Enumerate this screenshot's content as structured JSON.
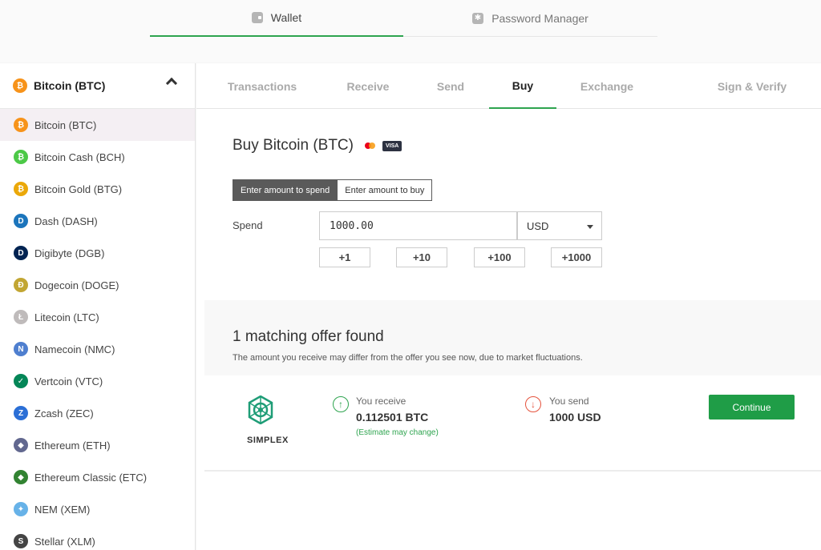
{
  "top_tabs": [
    {
      "label": "Wallet",
      "icon": "wallet-icon",
      "active": true
    },
    {
      "label": "Password Manager",
      "icon": "password-manager-icon",
      "active": false
    }
  ],
  "sidebar": {
    "selected": {
      "label": "Bitcoin (BTC)",
      "icon": "bitcoin-icon"
    },
    "coins": [
      {
        "label": "Bitcoin (BTC)",
        "icon": "bitcoin-icon",
        "color": "#f7931a",
        "glyph": "₿"
      },
      {
        "label": "Bitcoin Cash (BCH)",
        "icon": "bitcoin-cash-icon",
        "color": "#4cc947",
        "glyph": "₿"
      },
      {
        "label": "Bitcoin Gold (BTG)",
        "icon": "bitcoin-gold-icon",
        "color": "#eba809",
        "glyph": "₿"
      },
      {
        "label": "Dash (DASH)",
        "icon": "dash-icon",
        "color": "#1c75bc",
        "glyph": "D"
      },
      {
        "label": "Digibyte (DGB)",
        "icon": "digibyte-icon",
        "color": "#002352",
        "glyph": "D"
      },
      {
        "label": "Dogecoin (DOGE)",
        "icon": "dogecoin-icon",
        "color": "#c2a633",
        "glyph": "Ð"
      },
      {
        "label": "Litecoin (LTC)",
        "icon": "litecoin-icon",
        "color": "#bfbbbb",
        "glyph": "Ł"
      },
      {
        "label": "Namecoin (NMC)",
        "icon": "namecoin-icon",
        "color": "#4f7fcf",
        "glyph": "N"
      },
      {
        "label": "Vertcoin (VTC)",
        "icon": "vertcoin-icon",
        "color": "#048657",
        "glyph": "✓"
      },
      {
        "label": "Zcash (ZEC)",
        "icon": "zcash-icon",
        "color": "#2b6fd6",
        "glyph": "Z"
      },
      {
        "label": "Ethereum (ETH)",
        "icon": "ethereum-icon",
        "color": "#62688f",
        "glyph": "◆"
      },
      {
        "label": "Ethereum Classic (ETC)",
        "icon": "ethereum-classic-icon",
        "color": "#328332",
        "glyph": "◆"
      },
      {
        "label": "NEM (XEM)",
        "icon": "nem-icon",
        "color": "#67b2e8",
        "glyph": "✦"
      },
      {
        "label": "Stellar (XLM)",
        "icon": "stellar-icon",
        "color": "#444444",
        "glyph": "S"
      }
    ]
  },
  "tabs": [
    {
      "label": "Transactions",
      "active": false
    },
    {
      "label": "Receive",
      "active": false
    },
    {
      "label": "Send",
      "active": false
    },
    {
      "label": "Buy",
      "active": true
    },
    {
      "label": "Exchange",
      "active": false
    },
    {
      "label": "Sign & Verify",
      "active": false
    }
  ],
  "buy": {
    "title": "Buy Bitcoin (BTC)",
    "visa_label": "VISA",
    "toggle_spend": "Enter amount to spend",
    "toggle_buy": "Enter amount to buy",
    "spend_label": "Spend",
    "amount": "1000.00",
    "currency": "USD",
    "quick_amounts": [
      "+1",
      "+10",
      "+100",
      "+1000"
    ]
  },
  "offers": {
    "title": "1 matching offer found",
    "subtitle": "The amount you receive may differ from the offer you see now, due to market fluctuations.",
    "offer": {
      "provider": "SIMPLEX",
      "receive_label": "You receive",
      "receive_value": "0.112501 BTC",
      "receive_note": "(Estimate may change)",
      "send_label": "You send",
      "send_value": "1000 USD",
      "continue_label": "Continue"
    }
  },
  "colors": {
    "accent_green": "#2ea44f",
    "button_green": "#1f9d47",
    "send_red": "#e5533d"
  }
}
